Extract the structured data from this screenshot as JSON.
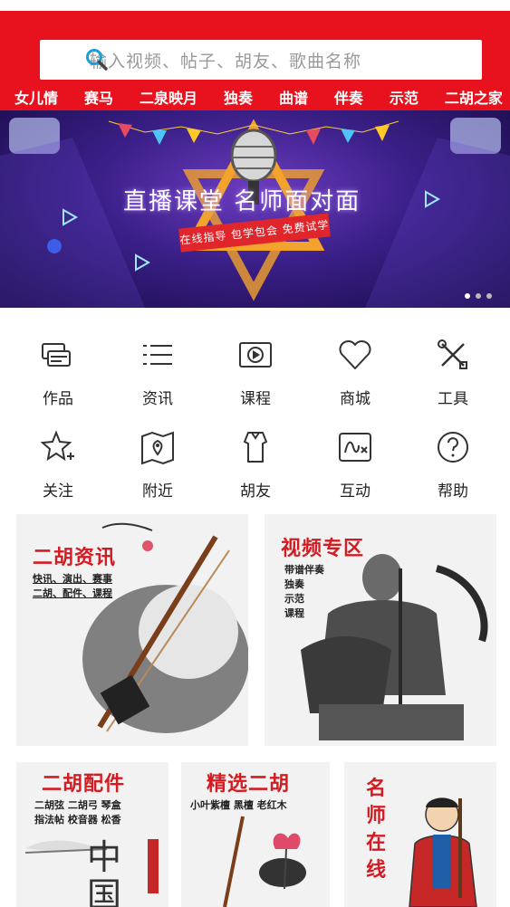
{
  "search": {
    "placeholder": "输入视频、帖子、胡友、歌曲名称",
    "icon": "search-icon"
  },
  "nav": [
    "女儿情",
    "赛马",
    "二泉映月",
    "独奏",
    "曲谱",
    "伴奏",
    "示范",
    "二胡之家"
  ],
  "banner": {
    "title": "直播课堂 名师面对面",
    "subtitle": "在线指导 包学包会 免费试学",
    "dots": 3,
    "active_dot": 0
  },
  "menu": [
    {
      "label": "作品",
      "icon": "works-icon"
    },
    {
      "label": "资讯",
      "icon": "news-icon"
    },
    {
      "label": "课程",
      "icon": "video-course-icon"
    },
    {
      "label": "商城",
      "icon": "heart-icon"
    },
    {
      "label": "工具",
      "icon": "tools-icon"
    },
    {
      "label": "关注",
      "icon": "star-icon"
    },
    {
      "label": "附近",
      "icon": "map-pin-icon"
    },
    {
      "label": "胡友",
      "icon": "friends-icon"
    },
    {
      "label": "互动",
      "icon": "interact-icon"
    },
    {
      "label": "帮助",
      "icon": "help-icon"
    }
  ],
  "cards": {
    "news": {
      "title": "二胡资讯",
      "lines": [
        "快讯、演出、赛事",
        "二胡、配件、课程"
      ]
    },
    "video": {
      "title": "视频专区",
      "lines": [
        "带谱伴奏",
        "独奏",
        "示范",
        "课程"
      ]
    },
    "parts": {
      "title": "二胡配件",
      "lines": [
        "二胡弦  二胡弓  琴盒",
        "指法帖  校音器  松香"
      ],
      "big": "中国"
    },
    "pick": {
      "title": "精选二胡",
      "lines": [
        "小叶紫檀  黑檀  老红木"
      ]
    },
    "teacher": {
      "title": "名师在线"
    }
  },
  "colors": {
    "brand_red": "#e8121e",
    "title_red": "#d31b22"
  }
}
